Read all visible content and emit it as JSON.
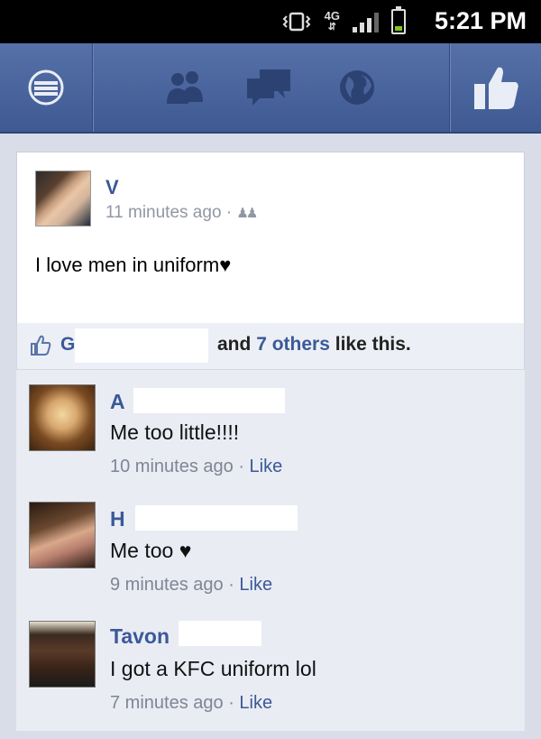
{
  "status_bar": {
    "network": "4G",
    "time": "5:21 PM",
    "colors": {
      "battery": "#7ec820"
    }
  },
  "nav": {
    "icons": [
      "menu-icon",
      "friend-requests-icon",
      "messages-icon",
      "notifications-globe-icon",
      "like-icon"
    ]
  },
  "post": {
    "author": "V",
    "time": "11 minutes ago",
    "separator": "·",
    "text": "I love men in uniform♥"
  },
  "likes": {
    "first_name": "G",
    "and": "and",
    "others": "7 others",
    "suffix": "like this."
  },
  "comments": [
    {
      "author": "A",
      "text": "Me too little!!!!",
      "time": "10 minutes ago",
      "like": "Like"
    },
    {
      "author": "H",
      "text": "Me too ♥",
      "time": "9 minutes ago",
      "like": "Like"
    },
    {
      "author": "Tavon",
      "text": "I got a KFC uniform lol",
      "time": "7 minutes ago",
      "like": "Like"
    }
  ],
  "colors": {
    "brand": "#3b5998",
    "navbar": "#4a639c"
  }
}
